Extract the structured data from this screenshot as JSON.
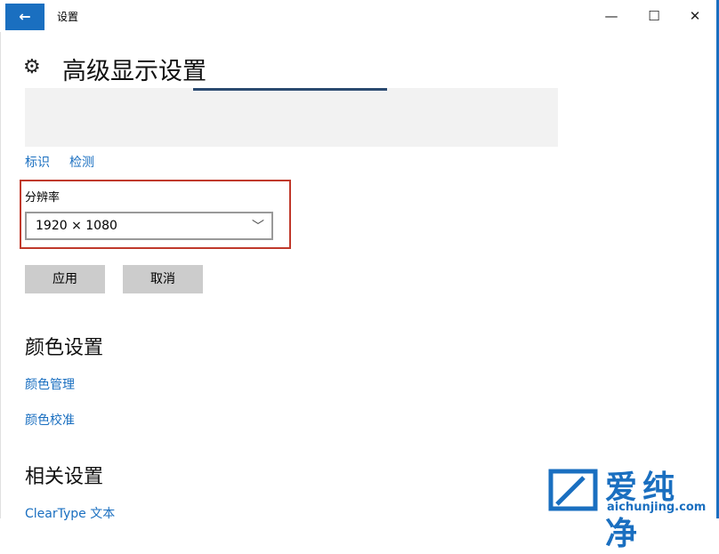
{
  "window": {
    "title": "设置",
    "back_icon": "←",
    "minimize_icon": "—",
    "maximize_icon": "☐",
    "close_icon": "✕"
  },
  "page": {
    "title": "高级显示设置",
    "gear_icon": "⚙"
  },
  "display": {
    "identify_label": "标识",
    "detect_label": "检测"
  },
  "resolution": {
    "label": "分辨率",
    "value": "1920 × 1080",
    "chevron": "﹀"
  },
  "actions": {
    "apply_label": "应用",
    "cancel_label": "取消"
  },
  "color_settings": {
    "heading": "颜色设置",
    "color_management_label": "颜色管理",
    "color_calibration_label": "颜色校准"
  },
  "related_settings": {
    "heading": "相关设置",
    "cleartype_label": "ClearType 文本"
  },
  "watermark": {
    "brand_text": "爱纯净",
    "url_text": "aichunjing.com"
  },
  "colors": {
    "accent": "#1a6fc0",
    "highlight_box": "#c0392b",
    "button_bg": "#cccccc"
  }
}
